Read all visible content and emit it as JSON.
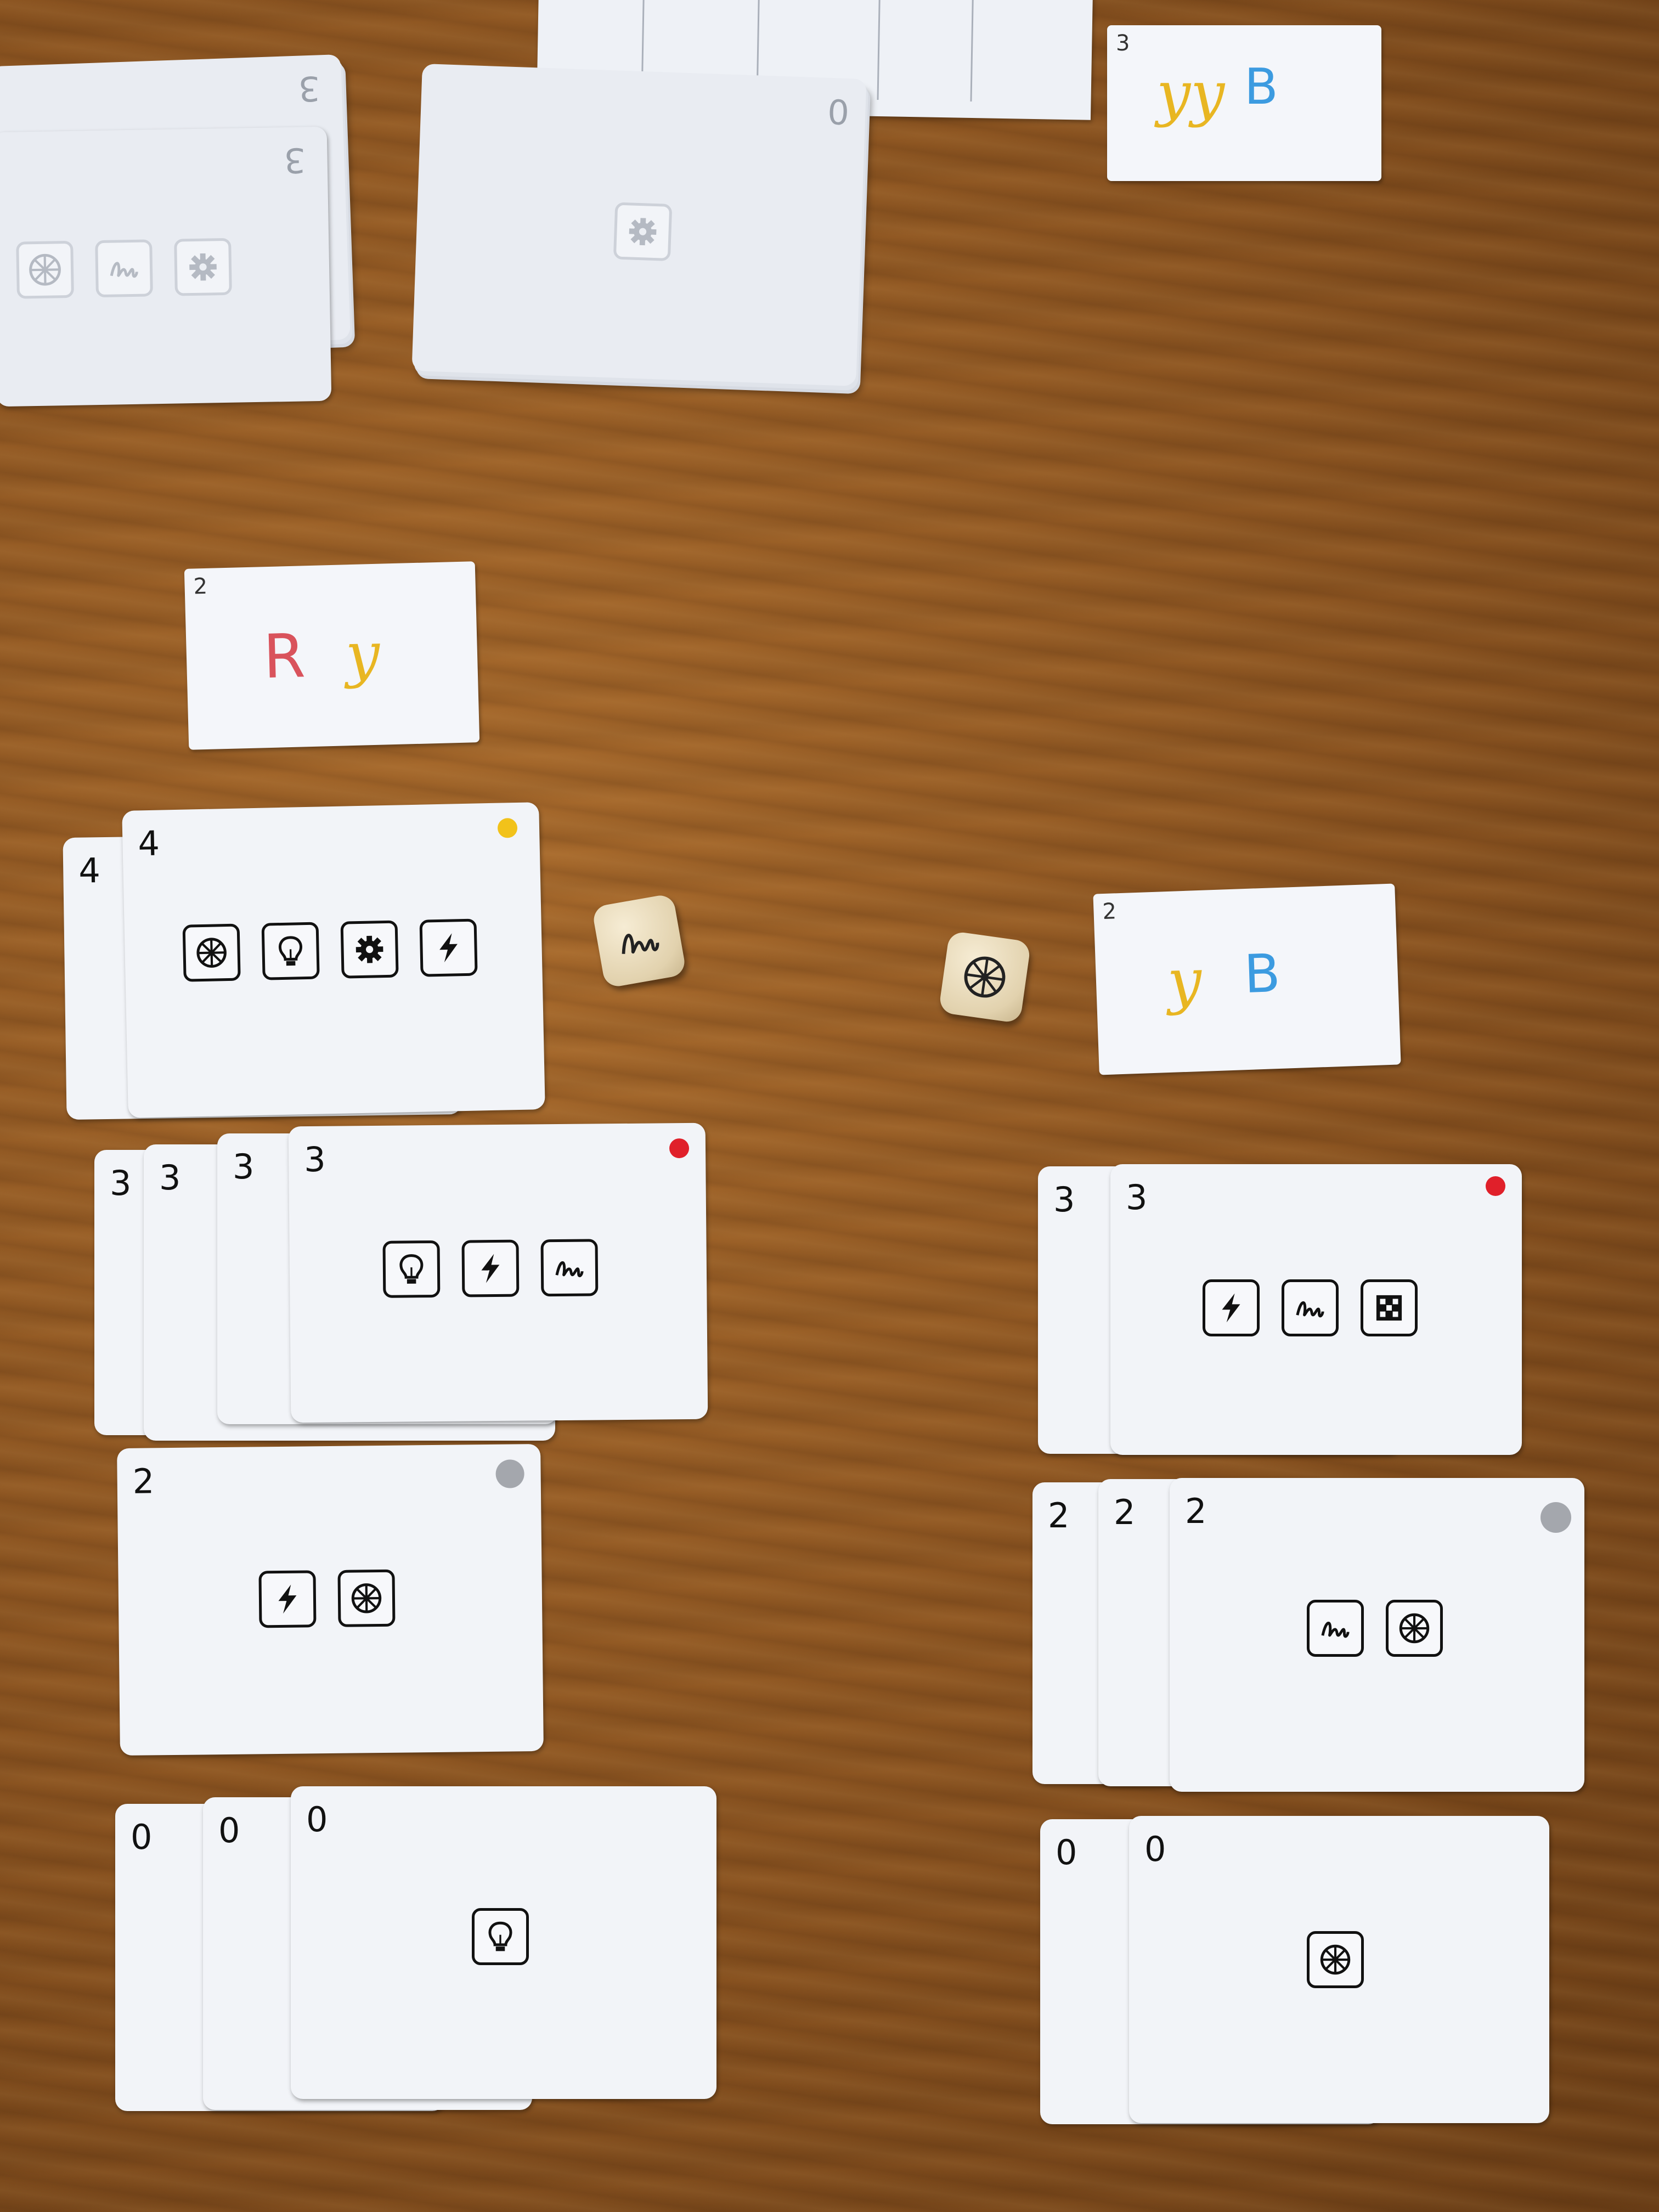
{
  "scene": "Card game tabletop",
  "colors": {
    "yellow": "#f2c21a",
    "red": "#e0202a",
    "gray": "#a4a7ad",
    "goal_R": "#d9535c",
    "goal_y": "#e8b622",
    "goal_B": "#3c9be0"
  },
  "goal_cards": {
    "top_right": {
      "number": "3",
      "letters": [
        {
          "text": "yy",
          "color": "#e8b622"
        },
        {
          "text": "B",
          "color": "#3c9be0"
        }
      ]
    },
    "left": {
      "number": "2",
      "letters": [
        {
          "text": "R",
          "color": "#d9535c"
        },
        {
          "text": "y",
          "color": "#e8b622"
        }
      ]
    },
    "right": {
      "number": "2",
      "letters": [
        {
          "text": "y",
          "color": "#e8b622"
        },
        {
          "text": "B",
          "color": "#3c9be0"
        }
      ]
    }
  },
  "draw_piles": {
    "left": {
      "number": "3",
      "back_number": "3",
      "icons": [
        "wheel-icon",
        "spring-icon",
        "gear-icon"
      ]
    },
    "middle": {
      "number": "0",
      "icons": [
        "gear-icon"
      ]
    }
  },
  "dice": [
    {
      "face": "spring-icon"
    },
    {
      "face": "wheel-icon"
    }
  ],
  "left_column": {
    "yellow_row": {
      "numbers": [
        "4",
        "4"
      ],
      "dot": "#f2c21a",
      "icons": [
        "wheel-icon",
        "bulb-icon",
        "gear-icon",
        "lightning-icon"
      ]
    },
    "red_row": {
      "numbers": [
        "3",
        "3",
        "3",
        "3"
      ],
      "dot": "#e0202a",
      "icons": [
        "bulb-icon",
        "lightning-icon",
        "spring-icon"
      ]
    },
    "gray_row": {
      "numbers": [
        "2"
      ],
      "dot": "#a4a7ad",
      "icons": [
        "lightning-icon",
        "wheel-icon"
      ]
    },
    "zero_row": {
      "numbers": [
        "0",
        "0",
        "0"
      ],
      "icons": [
        "bulb-icon"
      ]
    }
  },
  "right_column": {
    "red_row": {
      "numbers": [
        "3",
        "3"
      ],
      "dot": "#e0202a",
      "icons": [
        "lightning-icon",
        "spring-icon",
        "chip-icon"
      ]
    },
    "gray_row": {
      "numbers": [
        "2",
        "2",
        "2"
      ],
      "dot": "#a4a7ad",
      "icons": [
        "spring-icon",
        "wheel-icon"
      ]
    },
    "zero_row": {
      "numbers": [
        "0",
        "0"
      ],
      "icons": [
        "wheel-icon"
      ]
    }
  }
}
